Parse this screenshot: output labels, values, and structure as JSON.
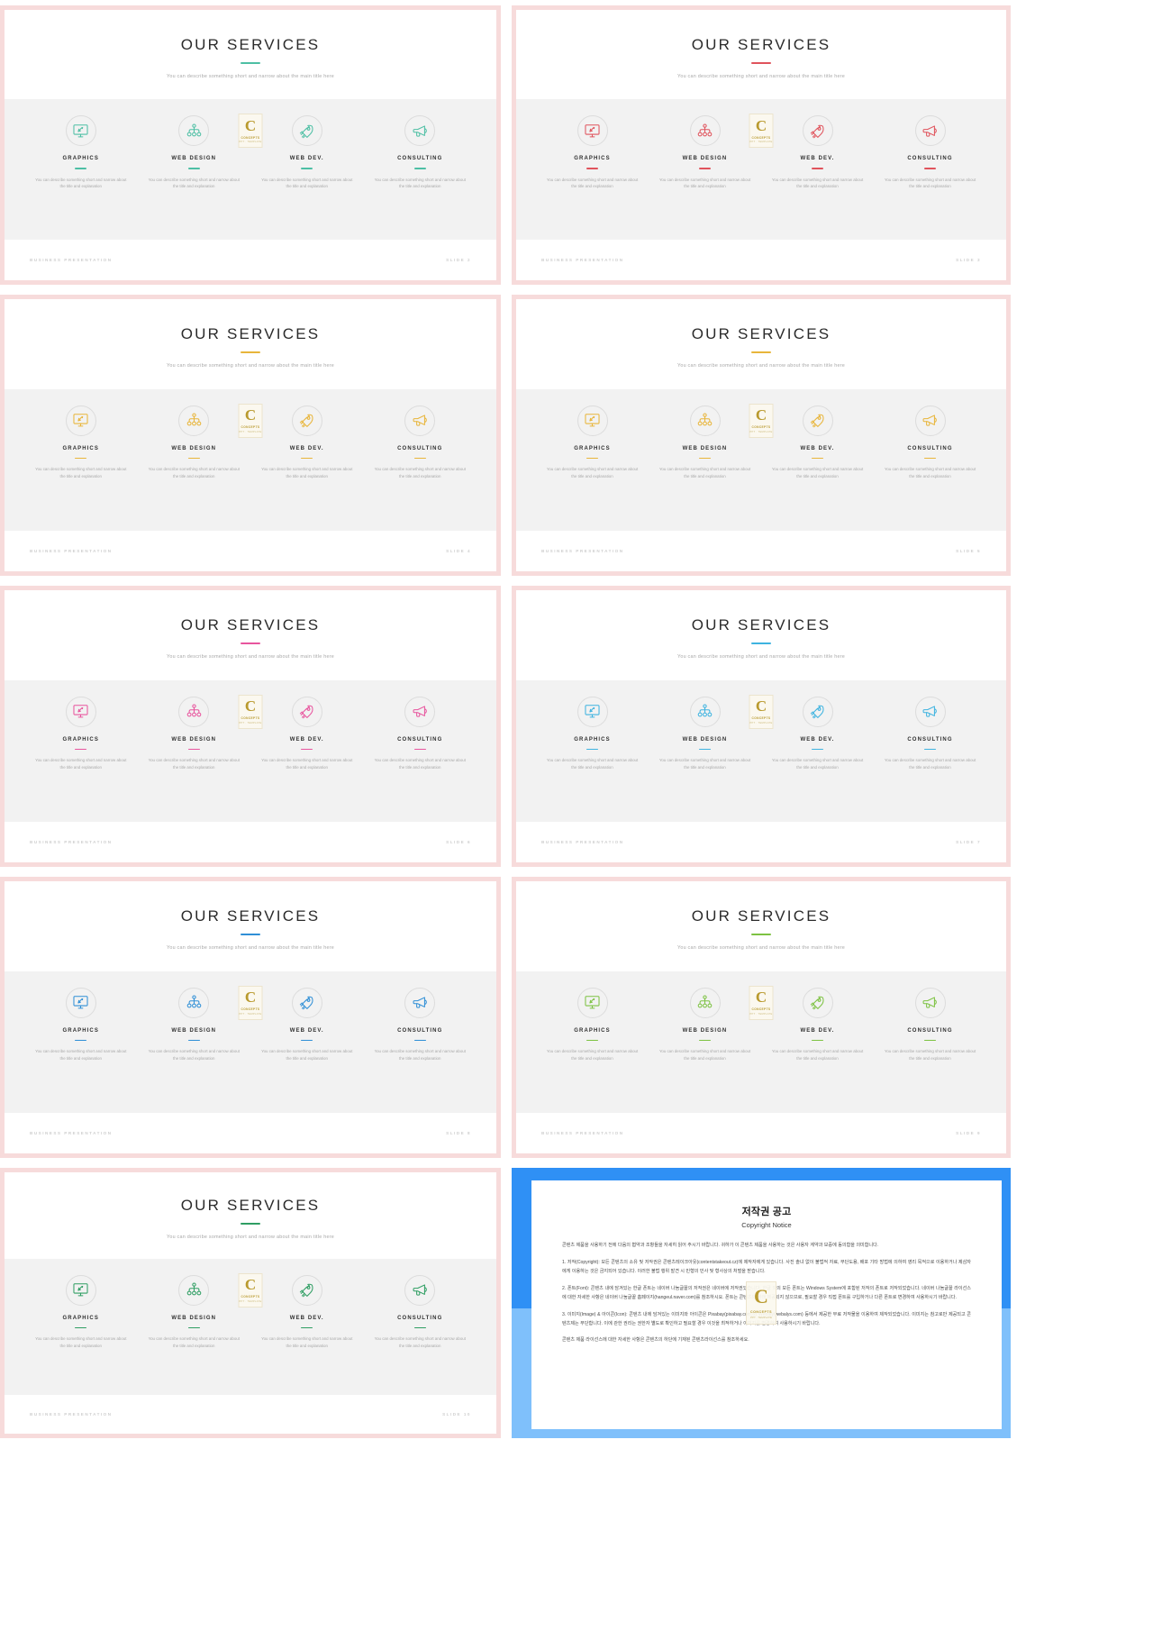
{
  "slides": [
    {
      "title": "OUR SERVICES",
      "subtitle": "You can describe something short and narrow about the main title here",
      "accent": "#4dbfa4",
      "footer_left": "BUSINESS PRESENTATION",
      "footer_right": "SLIDE 2",
      "cards": [
        {
          "name": "GRAPHICS",
          "icon": "monitor-icon",
          "desc": "You can describe something short and narrow about the title and explanation"
        },
        {
          "name": "WEB DESIGN",
          "icon": "sitemap-icon",
          "desc": "You can describe something short and narrow about the title and explanation"
        },
        {
          "name": "WEB DEV.",
          "icon": "rocket-icon",
          "desc": "You can describe something short and narrow about the title and explanation"
        },
        {
          "name": "CONSULTING",
          "icon": "megaphone-icon",
          "desc": "You can describe something short and narrow about the title and explanation"
        }
      ]
    },
    {
      "title": "OUR SERVICES",
      "subtitle": "You can describe something short and narrow about the main title here",
      "accent": "#e0535c",
      "footer_left": "BUSINESS PRESENTATION",
      "footer_right": "SLIDE 3",
      "cards": [
        {
          "name": "GRAPHICS",
          "icon": "monitor-icon",
          "desc": "You can describe something short and narrow about the title and explanation"
        },
        {
          "name": "WEB DESIGN",
          "icon": "sitemap-icon",
          "desc": "You can describe something short and narrow about the title and explanation"
        },
        {
          "name": "WEB DEV.",
          "icon": "rocket-icon",
          "desc": "You can describe something short and narrow about the title and explanation"
        },
        {
          "name": "CONSULTING",
          "icon": "megaphone-icon",
          "desc": "You can describe something short and narrow about the title and explanation"
        }
      ]
    },
    {
      "title": "OUR SERVICES",
      "subtitle": "You can describe something short and narrow about the main title here",
      "accent": "#e8b53a",
      "footer_left": "BUSINESS PRESENTATION",
      "footer_right": "SLIDE 4",
      "cards": [
        {
          "name": "GRAPHICS",
          "icon": "monitor-icon",
          "desc": "You can describe something short and narrow about the title and explanation"
        },
        {
          "name": "WEB DESIGN",
          "icon": "sitemap-icon",
          "desc": "You can describe something short and narrow about the title and explanation"
        },
        {
          "name": "WEB DEV.",
          "icon": "rocket-icon",
          "desc": "You can describe something short and narrow about the title and explanation"
        },
        {
          "name": "CONSULTING",
          "icon": "megaphone-icon",
          "desc": "You can describe something short and narrow about the title and explanation"
        }
      ]
    },
    {
      "title": "OUR SERVICES",
      "subtitle": "You can describe something short and narrow about the main title here",
      "accent": "#e8b53a",
      "footer_left": "BUSINESS PRESENTATION",
      "footer_right": "SLIDE 5",
      "cards": [
        {
          "name": "GRAPHICS",
          "icon": "monitor-icon",
          "desc": "You can describe something short and narrow about the title and explanation"
        },
        {
          "name": "WEB DESIGN",
          "icon": "sitemap-icon",
          "desc": "You can describe something short and narrow about the title and explanation"
        },
        {
          "name": "WEB DEV.",
          "icon": "rocket-icon",
          "desc": "You can describe something short and narrow about the title and explanation"
        },
        {
          "name": "CONSULTING",
          "icon": "megaphone-icon",
          "desc": "You can describe something short and narrow about the title and explanation"
        }
      ]
    },
    {
      "title": "OUR SERVICES",
      "subtitle": "You can describe something short and narrow about the main title here",
      "accent": "#e8559e",
      "footer_left": "BUSINESS PRESENTATION",
      "footer_right": "SLIDE 6",
      "cards": [
        {
          "name": "GRAPHICS",
          "icon": "monitor-icon",
          "desc": "You can describe something short and narrow about the title and explanation"
        },
        {
          "name": "WEB DESIGN",
          "icon": "sitemap-icon",
          "desc": "You can describe something short and narrow about the title and explanation"
        },
        {
          "name": "WEB DEV.",
          "icon": "rocket-icon",
          "desc": "You can describe something short and narrow about the title and explanation"
        },
        {
          "name": "CONSULTING",
          "icon": "megaphone-icon",
          "desc": "You can describe something short and narrow about the title and explanation"
        }
      ]
    },
    {
      "title": "OUR SERVICES",
      "subtitle": "You can describe something short and narrow about the main title here",
      "accent": "#3eb3e0",
      "footer_left": "BUSINESS PRESENTATION",
      "footer_right": "SLIDE 7",
      "cards": [
        {
          "name": "GRAPHICS",
          "icon": "monitor-icon",
          "desc": "You can describe something short and narrow about the title and explanation"
        },
        {
          "name": "WEB DESIGN",
          "icon": "sitemap-icon",
          "desc": "You can describe something short and narrow about the title and explanation"
        },
        {
          "name": "WEB DEV.",
          "icon": "rocket-icon",
          "desc": "You can describe something short and narrow about the title and explanation"
        },
        {
          "name": "CONSULTING",
          "icon": "megaphone-icon",
          "desc": "You can describe something short and narrow about the title and explanation"
        }
      ]
    },
    {
      "title": "OUR SERVICES",
      "subtitle": "You can describe something short and narrow about the main title here",
      "accent": "#2f8fd6",
      "footer_left": "BUSINESS PRESENTATION",
      "footer_right": "SLIDE 8",
      "cards": [
        {
          "name": "GRAPHICS",
          "icon": "monitor-icon",
          "desc": "You can describe something short and narrow about the title and explanation"
        },
        {
          "name": "WEB DESIGN",
          "icon": "sitemap-icon",
          "desc": "You can describe something short and narrow about the title and explanation"
        },
        {
          "name": "WEB DEV.",
          "icon": "rocket-icon",
          "desc": "You can describe something short and narrow about the title and explanation"
        },
        {
          "name": "CONSULTING",
          "icon": "megaphone-icon",
          "desc": "You can describe something short and narrow about the title and explanation"
        }
      ]
    },
    {
      "title": "OUR SERVICES",
      "subtitle": "You can describe something short and narrow about the main title here",
      "accent": "#7dc242",
      "footer_left": "BUSINESS PRESENTATION",
      "footer_right": "SLIDE 9",
      "cards": [
        {
          "name": "GRAPHICS",
          "icon": "monitor-icon",
          "desc": "You can describe something short and narrow about the title and explanation"
        },
        {
          "name": "WEB DESIGN",
          "icon": "sitemap-icon",
          "desc": "You can describe something short and narrow about the title and explanation"
        },
        {
          "name": "WEB DEV.",
          "icon": "rocket-icon",
          "desc": "You can describe something short and narrow about the title and explanation"
        },
        {
          "name": "CONSULTING",
          "icon": "megaphone-icon",
          "desc": "You can describe something short and narrow about the title and explanation"
        }
      ]
    },
    {
      "title": "OUR SERVICES",
      "subtitle": "You can describe something short and narrow about the main title here",
      "accent": "#2f9e63",
      "footer_left": "BUSINESS PRESENTATION",
      "footer_right": "SLIDE 10",
      "cards": [
        {
          "name": "GRAPHICS",
          "icon": "monitor-icon",
          "desc": "You can describe something short and narrow about the title and explanation"
        },
        {
          "name": "WEB DESIGN",
          "icon": "sitemap-icon",
          "desc": "You can describe something short and narrow about the title and explanation"
        },
        {
          "name": "WEB DEV.",
          "icon": "rocket-icon",
          "desc": "You can describe something short and narrow about the title and explanation"
        },
        {
          "name": "CONSULTING",
          "icon": "megaphone-icon",
          "desc": "You can describe something short and narrow about the title and explanation"
        }
      ]
    }
  ],
  "watermark": {
    "letter": "C",
    "line1": "CONCEPTS",
    "line2": "PPT · TEMPLATE"
  },
  "copyright": {
    "title": "저작권 공고",
    "subtitle": "Copyright Notice",
    "paragraphs": [
      "콘텐츠 제품을 사용하기 전에 다음의 협약과 조항들을 자세히 읽어 주시기 바랍니다. 귀하가 이 콘텐츠 제품을 사용하는 것은 사용자 계약과 보증에 동의함을 의미합니다.",
      "1. 저작(Copyright): 모든 콘텐츠의 소유 및 저작권은 콘텐츠레이크아웃(contentstakeout.cz)에 제작자에게 있습니다. 사진 솔녀 없이 불법적 자료, 무단도용, 배포 기타 방법에 의하여 영리 목적으로 이용하거나 제삼자에게 이용하는 것은 금지되어 있습니다. 이러한 불법 행위 발견 시 민형의 민사 및 형사상의 처벌을 받습니다.",
      "2. 폰트(Font): 콘텐츠 내에 담겨있는 한글 폰트는 네이버 나눔글꼴의 저작권은 네이버에 저작권있습니다. 한글 외의 모든 폰트는 Windows System에 포함된 저작의 폰트로 저작되었습니다. 네이버 나눔글꼴 라이선스에 대한 자세한 사항은 네이버 나눔글꼴 홈페이지(hangeul.naver.com)를 참조하시요. 폰트는 콘텐츠의 원래 제공되지 않으므로, 필요할 경우 직접 폰트를 구입하거나 다른 폰트로 변경하여 사용하시기 바랍니다.",
      "3. 이미지(Image) & 아이콘(Icon): 콘텐츠 내에 담겨있는 이미지와 아이콘은 Pixabay(pixabay.com)와 Webaly(webalys.com) 등에서 제공한 무료 저작물을 이용하여 제작되었습니다. 이미지는 참고로만 제공되고 콘텐츠제는 무단합니다. 이에 관한 권리는 권한자 별도로 확인하고 필요할 경우 이것을 최적하거나 이미지를 변경하여 사용하시기 바랍니다.",
      "콘텐츠 제품 라이선스에 대한 자세한 사항은 콘텐츠의 하단에 기재된 콘텐츠라이선스를 참조하세요."
    ]
  }
}
